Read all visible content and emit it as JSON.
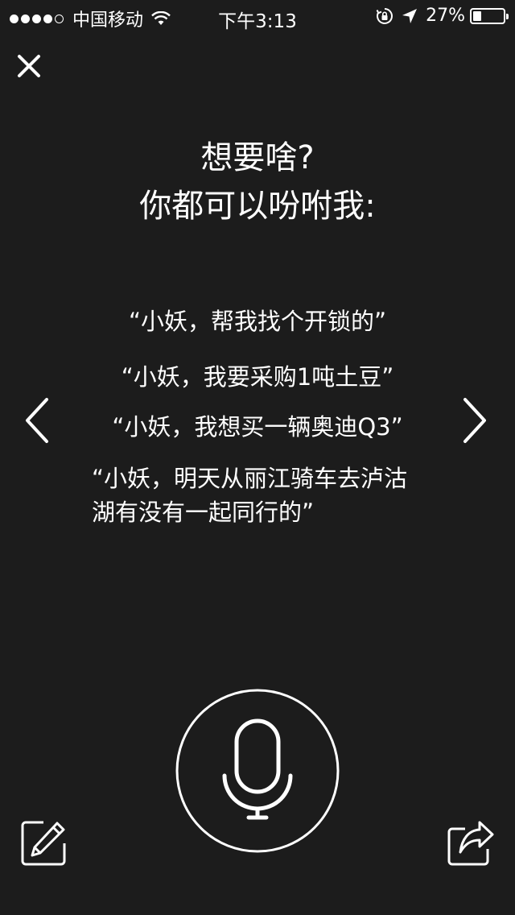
{
  "status_bar": {
    "signal_filled": 4,
    "signal_total": 5,
    "carrier": "中国移动",
    "time": "下午3:13",
    "battery_percent_text": "27%",
    "battery_level": 0.27,
    "icons": [
      "wifi-icon",
      "rotation-lock-icon",
      "location-arrow-icon",
      "battery-icon"
    ]
  },
  "header": {
    "close_icon": "close-icon"
  },
  "title": {
    "line1": "想要啥?",
    "line2": "你都可以吩咐我:"
  },
  "examples": [
    "“小妖，帮我找个开锁的”",
    "“小妖，我要采购1吨土豆”",
    "“小妖，我想买一辆奥迪Q3”",
    "“小妖，明天从丽江骑车去泸沽湖有没有一起同行的”"
  ],
  "navigation": {
    "prev_icon": "chevron-left-icon",
    "next_icon": "chevron-right-icon"
  },
  "footer": {
    "mic_icon": "microphone-icon",
    "edit_icon": "edit-pencil-icon",
    "share_icon": "share-icon"
  },
  "colors": {
    "background": "#1c1c1c",
    "foreground": "#ffffff"
  }
}
